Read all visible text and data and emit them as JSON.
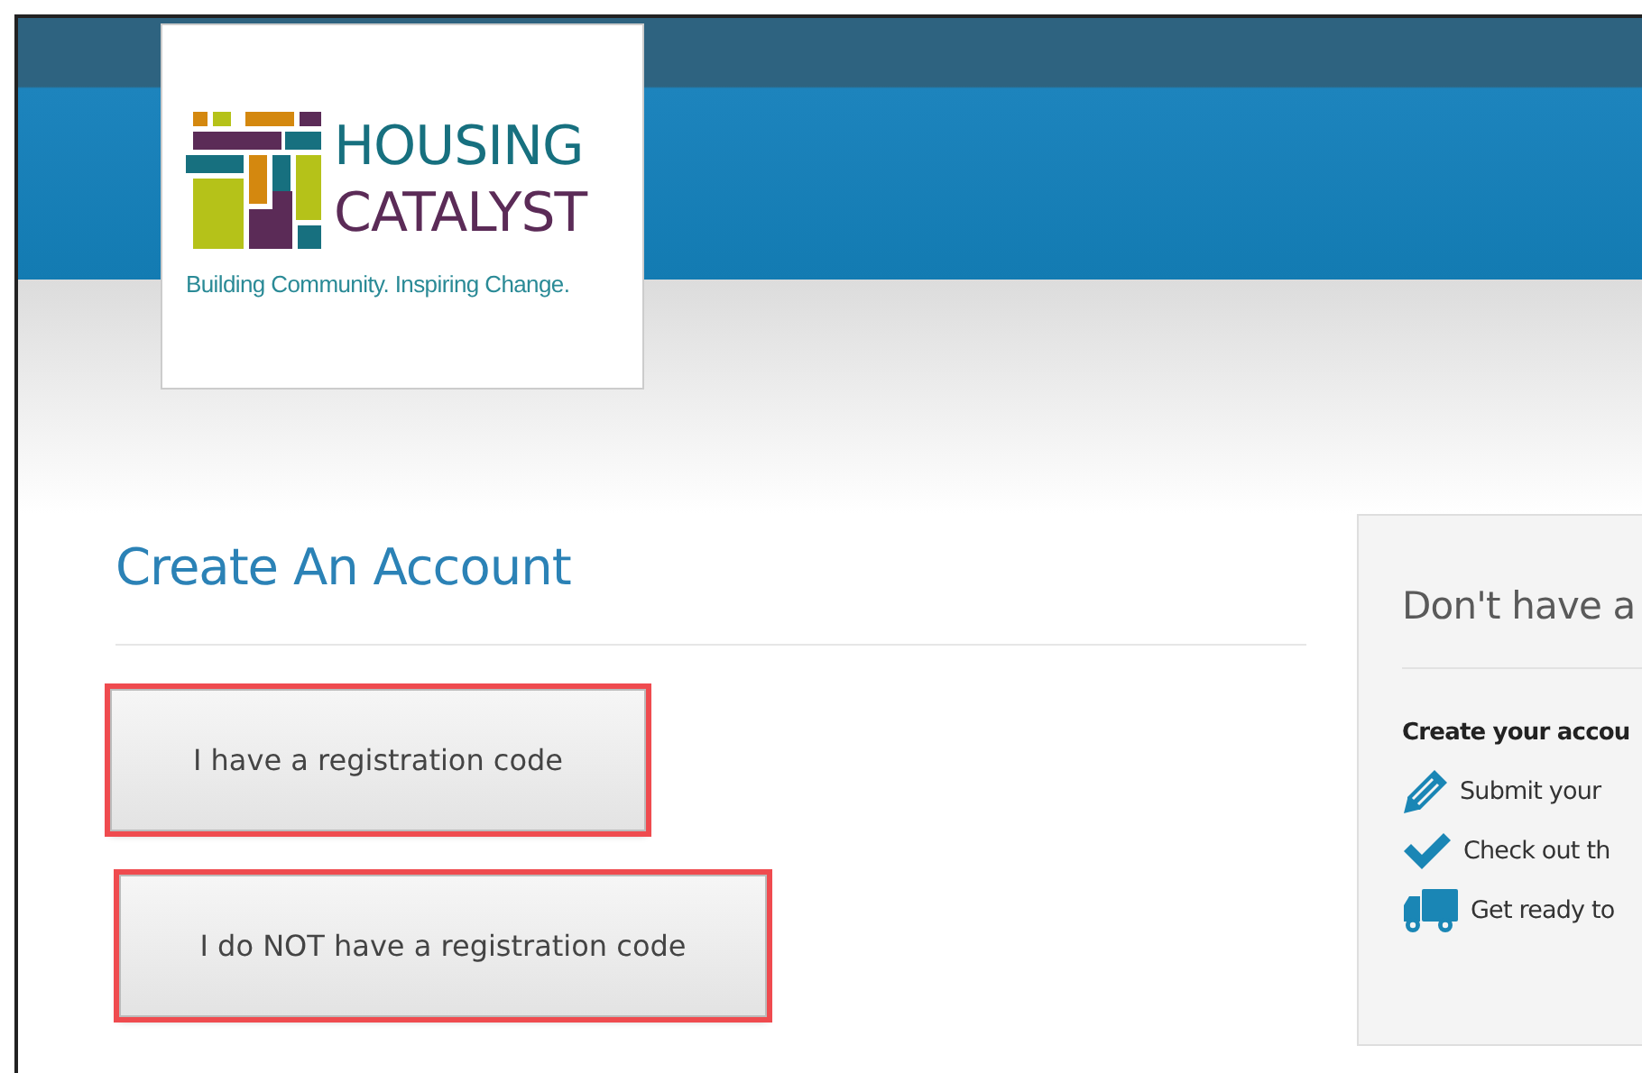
{
  "logo": {
    "name_line_1": "HOUSING",
    "name_line_2": "CATALYST",
    "tagline": "Building Community. Inspiring Change."
  },
  "account": {
    "title": "Create An Account",
    "buttons": [
      {
        "label": "I have a registration code",
        "highlighted": true
      },
      {
        "label": "I do NOT have a registration code",
        "highlighted": true
      }
    ]
  },
  "side_panel": {
    "title": "Don't have a",
    "subtitle": "Create your accou",
    "steps": [
      {
        "text": "Submit your"
      },
      {
        "text": "Check out th"
      },
      {
        "text": "Get ready to"
      }
    ]
  }
}
